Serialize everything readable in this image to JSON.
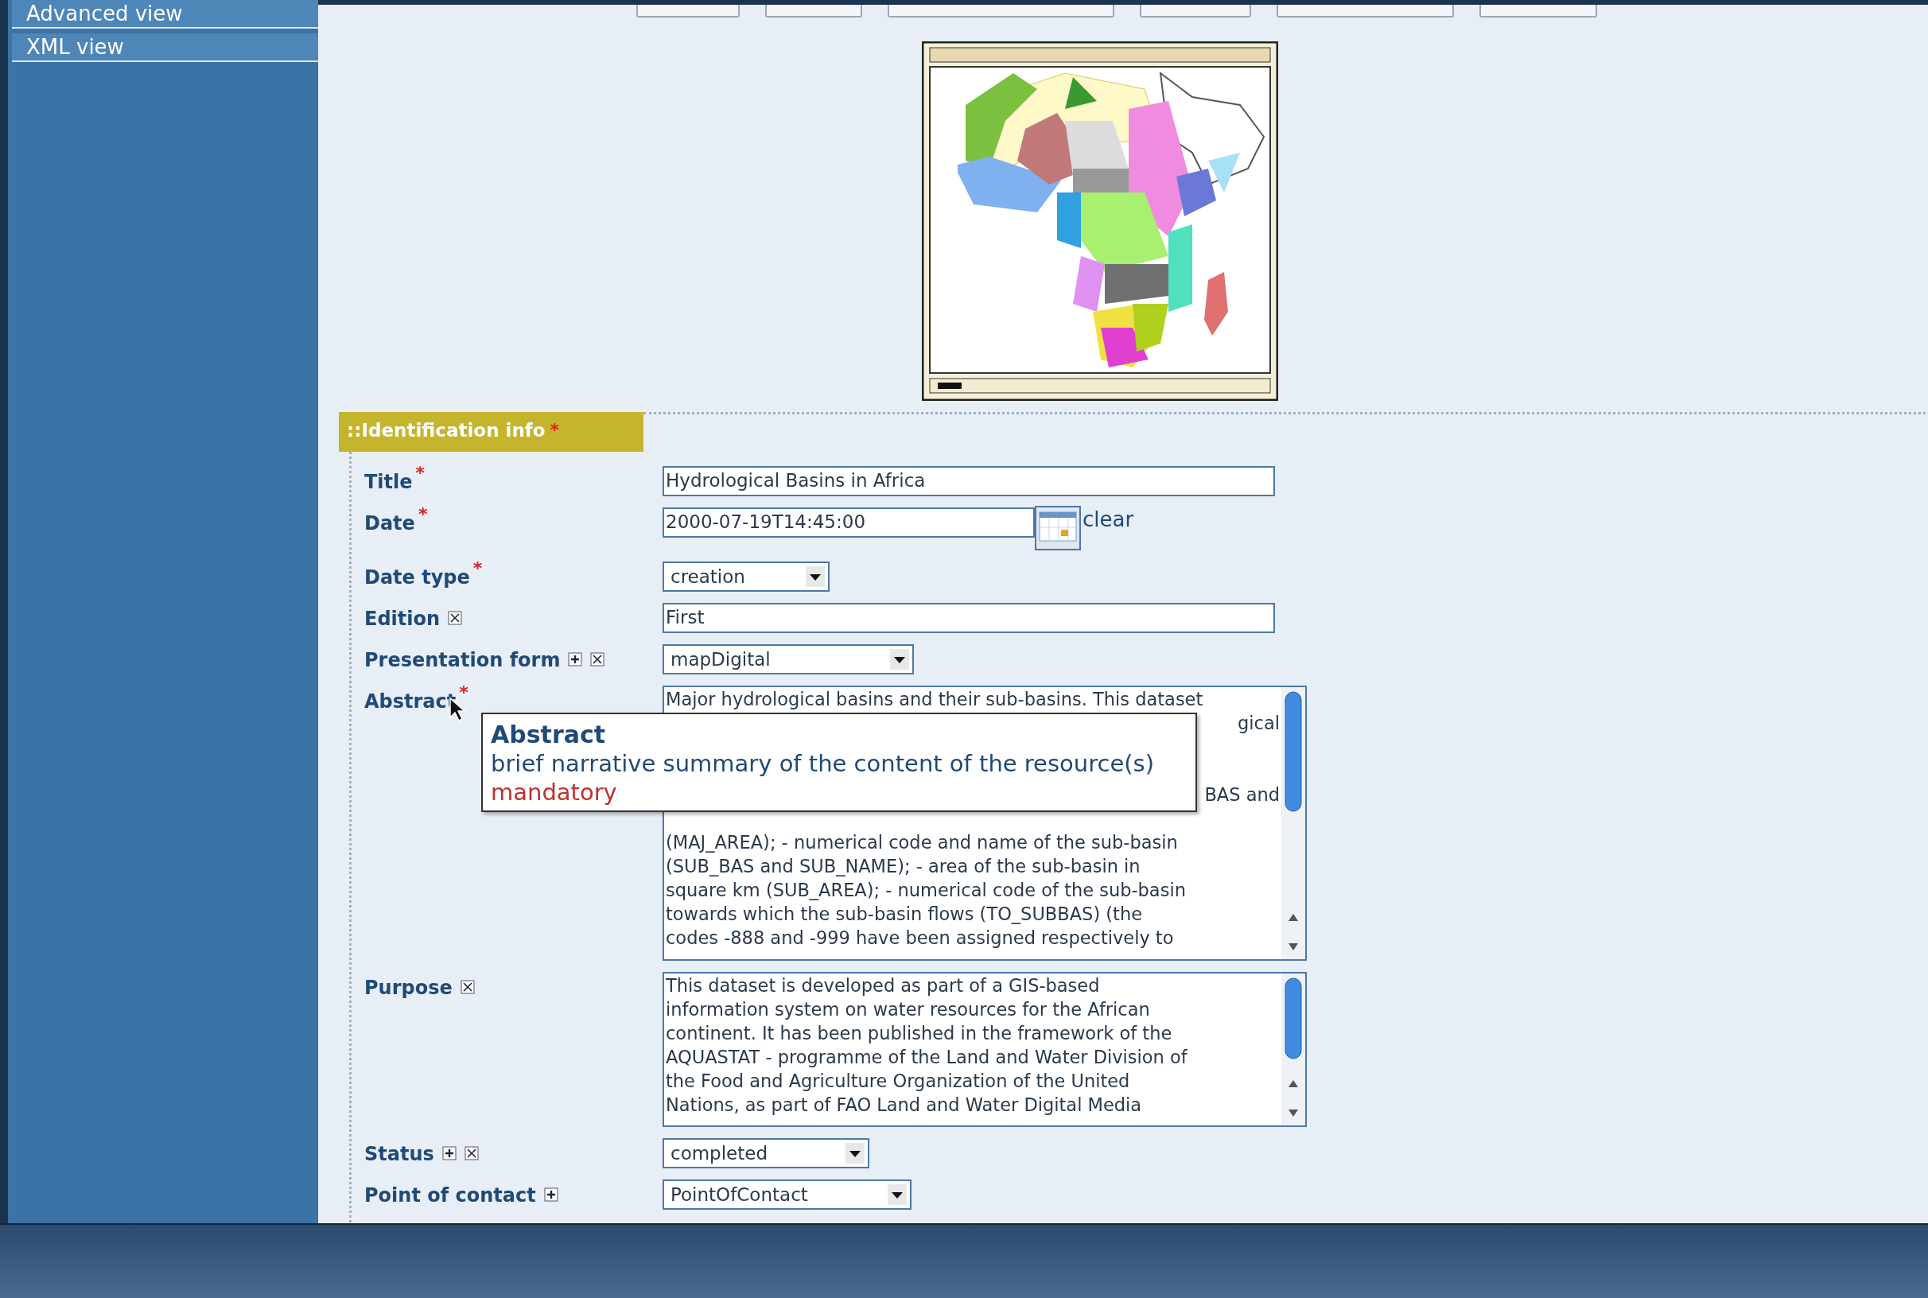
{
  "sidebar": {
    "items": [
      {
        "label": "Advanced view"
      },
      {
        "label": "XML view"
      }
    ]
  },
  "section": {
    "title": "::Identification info",
    "required_mark": "*"
  },
  "fields": [
    {
      "kind": "text",
      "label": "Title",
      "required_mark": "*",
      "add": false,
      "remove": false,
      "value": "Hydrological Basins in Africa"
    },
    {
      "kind": "date",
      "label": "Date",
      "required_mark": "*",
      "add": false,
      "remove": false,
      "value": "2000-07-19T14:45:00",
      "clear_link": "clear"
    },
    {
      "kind": "select",
      "label": "Date type",
      "required_mark": "*",
      "add": false,
      "remove": false,
      "value": "creation"
    },
    {
      "kind": "text",
      "label": "Edition",
      "add": false,
      "remove": true,
      "value": "First"
    },
    {
      "kind": "select",
      "label": "Presentation form",
      "add": true,
      "remove": true,
      "value": "mapDigital"
    },
    {
      "kind": "textarea",
      "label": "Abstract",
      "required_mark": "*",
      "add": false,
      "remove": false,
      "lines": [
        {
          "kind": "full",
          "text": "Major hydrological basins and their sub-basins. This dataset"
        },
        {
          "kind": "tail",
          "text": "gical"
        },
        {
          "kind": "covered"
        },
        {
          "kind": "covered"
        },
        {
          "kind": "tail",
          "text": "BAS and"
        },
        {
          "kind": "covered"
        },
        {
          "kind": "full",
          "text": "(MAJ_AREA); - numerical code and name of the sub-basin"
        },
        {
          "kind": "full",
          "text": "(SUB_BAS and SUB_NAME); - area of the sub-basin in"
        },
        {
          "kind": "full",
          "text": "square km (SUB_AREA); - numerical code of the sub-basin"
        },
        {
          "kind": "full",
          "text": "towards which the sub-basin flows (TO_SUBBAS) (the"
        },
        {
          "kind": "full",
          "text": "codes -888 and -999 have been assigned respectively to"
        }
      ]
    },
    {
      "kind": "textarea",
      "label": "Purpose",
      "add": false,
      "remove": true,
      "lines": [
        {
          "kind": "full",
          "text": "This dataset is developed as part of a GIS-based"
        },
        {
          "kind": "full",
          "text": "information system on water resources for the African"
        },
        {
          "kind": "full",
          "text": "continent. It has been published in the framework of the"
        },
        {
          "kind": "full",
          "text": "AQUASTAT - programme of the Land and Water Division of"
        },
        {
          "kind": "full",
          "text": "the Food and Agriculture Organization of the United"
        },
        {
          "kind": "full",
          "text": "Nations, as part of FAO Land and Water Digital Media"
        }
      ]
    },
    {
      "kind": "select",
      "label": "Status",
      "add": true,
      "remove": true,
      "value": "completed"
    },
    {
      "kind": "select",
      "label": "Point of contact",
      "add": true,
      "remove": false,
      "value": "PointOfContact"
    }
  ],
  "tooltip": {
    "title": "Abstract",
    "description": "brief narrative summary of the content of the resource(s)",
    "note": "mandatory"
  }
}
